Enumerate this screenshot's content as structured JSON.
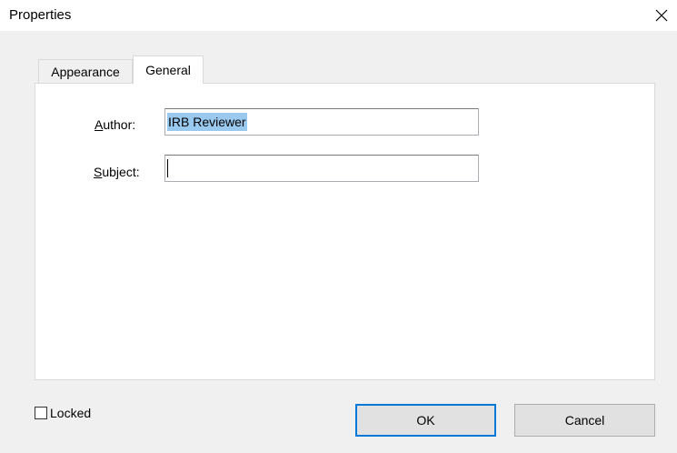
{
  "window": {
    "title": "Properties",
    "close_glyph": "✕"
  },
  "tabs": [
    {
      "label": "Appearance",
      "selected": false
    },
    {
      "label": "General",
      "selected": true
    }
  ],
  "form": {
    "author": {
      "label_mnemonic": "A",
      "label_rest": "uthor:",
      "value": "IRB Reviewer"
    },
    "subject": {
      "label_mnemonic": "S",
      "label_rest": "ubject:",
      "value": ""
    }
  },
  "locked": {
    "label": "Locked",
    "checked": false
  },
  "buttons": {
    "ok_label": "OK",
    "cancel_label": "Cancel"
  },
  "colors": {
    "selection": "#99c9ef",
    "default_button_border": "#0078d7"
  },
  "icons": {
    "close": "close-icon"
  }
}
